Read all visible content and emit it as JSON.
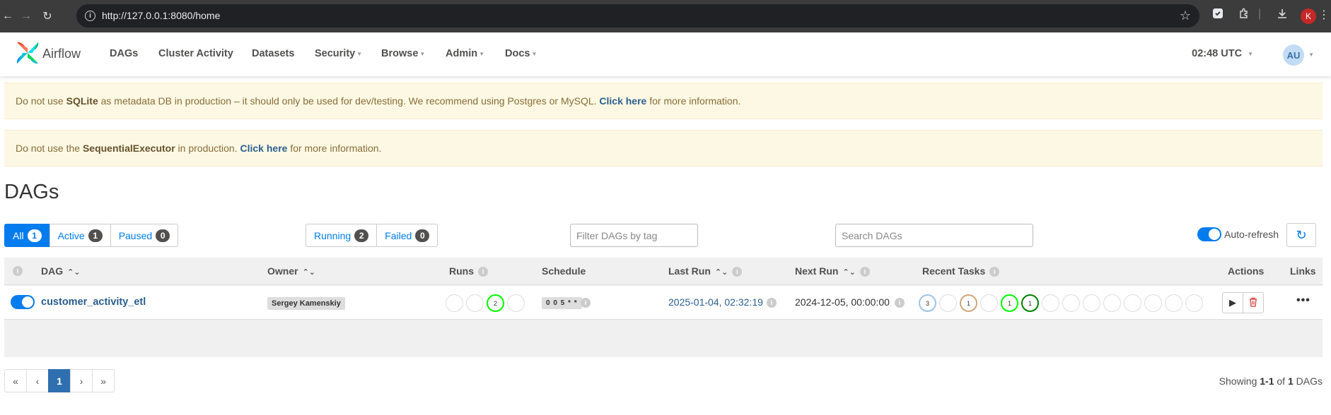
{
  "browser": {
    "url": "http://127.0.0.1:8080/home",
    "profile_initial": "K"
  },
  "navbar": {
    "brand": "Airflow",
    "menu": [
      "DAGs",
      "Cluster Activity",
      "Datasets",
      "Security",
      "Browse",
      "Admin",
      "Docs"
    ],
    "time": "02:48 UTC",
    "user_initials": "AU"
  },
  "alerts": [
    {
      "pre": "Do not use ",
      "strong": "SQLite",
      "mid": " as metadata DB in production – it should only be used for dev/testing. We recommend using Postgres or MySQL. ",
      "link": "Click here",
      "post": " for more information."
    },
    {
      "pre": "Do not use the ",
      "strong": "SequentialExecutor",
      "mid": " in production. ",
      "link": "Click here",
      "post": " for more information."
    }
  ],
  "page_title": "DAGs",
  "status_filter": [
    {
      "label": "All",
      "count": "1",
      "active": true
    },
    {
      "label": "Active",
      "count": "1",
      "active": false
    },
    {
      "label": "Paused",
      "count": "0",
      "active": false
    }
  ],
  "run_filter": [
    {
      "label": "Running",
      "count": "2"
    },
    {
      "label": "Failed",
      "count": "0"
    }
  ],
  "tag_filter_placeholder": "Filter DAGs by tag",
  "search_placeholder": "Search DAGs",
  "auto_refresh": {
    "label": "Auto-refresh",
    "enabled": true
  },
  "table": {
    "headers": {
      "dag": "DAG",
      "owner": "Owner",
      "runs": "Runs",
      "schedule": "Schedule",
      "last_run": "Last Run",
      "next_run": "Next Run",
      "recent_tasks": "Recent Tasks",
      "actions": "Actions",
      "links": "Links"
    },
    "rows": [
      {
        "dag_id": "customer_activity_etl",
        "paused": false,
        "owner": "Sergey Kamenskiy",
        "runs": [
          {
            "state": "queued",
            "count": ""
          },
          {
            "state": "success",
            "count": ""
          },
          {
            "state": "running",
            "count": "2"
          },
          {
            "state": "failed",
            "count": ""
          }
        ],
        "schedule": "0 0 5 * *",
        "last_run": "2025-01-04, 02:32:19",
        "next_run": "2024-12-05, 00:00:00",
        "recent_tasks": [
          {
            "state": "deferred",
            "count": "3"
          },
          {
            "state": "removed",
            "count": ""
          },
          {
            "state": "upstream_failed",
            "count": "1"
          },
          {
            "state": "queued",
            "count": ""
          },
          {
            "state": "running",
            "count": "1"
          },
          {
            "state": "success",
            "count": "1"
          },
          {
            "state": "restarting",
            "count": ""
          },
          {
            "state": "failed",
            "count": ""
          },
          {
            "state": "up_for_retry",
            "count": ""
          },
          {
            "state": "up_for_reschedule",
            "count": ""
          },
          {
            "state": "skipped",
            "count": ""
          },
          {
            "state": "scheduled",
            "count": ""
          },
          {
            "state": "shutdown",
            "count": ""
          },
          {
            "state": "none",
            "count": ""
          }
        ]
      }
    ]
  },
  "state_colors": {
    "deferred": "#9cc4e4",
    "upstream_failed": "#d2a679",
    "running": "#00ff00",
    "success": "#008000",
    "default": "#dddddd"
  },
  "pagination": {
    "first": "«",
    "prev": "‹",
    "current": "1",
    "next": "›",
    "last": "»"
  },
  "showing": {
    "pre": "Showing ",
    "range": "1-1",
    "mid": " of ",
    "total": "1",
    "post": " DAGs"
  }
}
